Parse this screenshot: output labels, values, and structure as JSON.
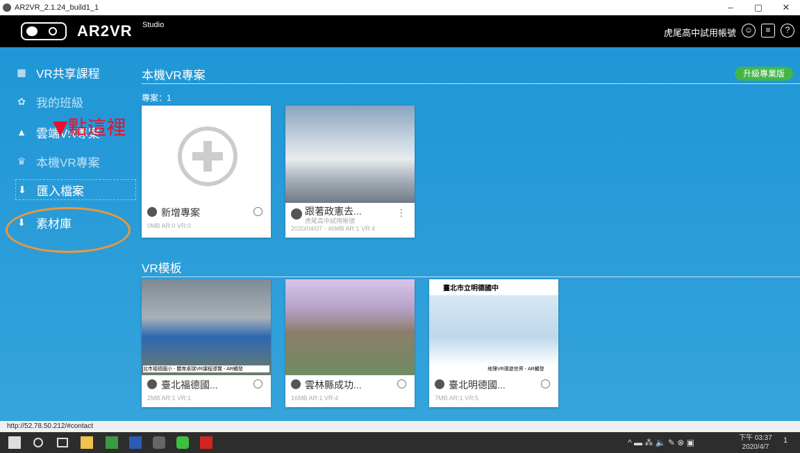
{
  "window": {
    "title": "AR2VR_2.1.24_build1_1",
    "min": "–",
    "max": "▢",
    "close": "✕"
  },
  "header": {
    "brand": "AR2VR",
    "brand_sub": "Studio",
    "account": "虎尾高中試用帳號",
    "icons": [
      "user-icon",
      "document-icon",
      "help-icon"
    ],
    "help_glyph": "?"
  },
  "sidebar": {
    "items": [
      {
        "label": "VR共享課程",
        "icon": "grid-icon"
      },
      {
        "label": "我的班級",
        "icon": "group-icon"
      },
      {
        "label": "雲端VR專案",
        "icon": "cloud-icon"
      },
      {
        "label": "本機VR專案",
        "icon": "local-icon"
      },
      {
        "label": "匯入檔案",
        "icon": "import-icon"
      },
      {
        "label": "素材庫",
        "icon": "library-icon"
      }
    ]
  },
  "annotation": {
    "text": "▼點這裡",
    "color": "#e8102a"
  },
  "local": {
    "title": "本機VR專案",
    "count": "專案：1",
    "upgrade": "升級專業版",
    "cards": [
      {
        "title": "新增專案",
        "meta": "0MB AR:0 VR:0"
      },
      {
        "title": "跟著政憲去...",
        "subtitle": "虎尾高中試用帳號",
        "meta": "2020/04/07 - 46MB AR:1 VR:4"
      }
    ]
  },
  "templates": {
    "title": "VR模板",
    "cards": [
      {
        "title": "臺北福德國...",
        "meta": "2MB AR:1 VR:1",
        "caption": "北市福德國小 - 體育桌球VR課程導覽 - AR觸發"
      },
      {
        "title": "雲林縣成功...",
        "meta": "16MB AR:1 VR:4"
      },
      {
        "title": "臺北明德國...",
        "meta": "7MB AR:1 VR:5",
        "banner": "臺北市立明德國中",
        "caption": "地理VR環遊世界 - AR觸發"
      }
    ]
  },
  "statusbar": {
    "url": "http://52.78.50.212/#contact"
  },
  "taskbar": {
    "time": "下午 03:37",
    "date": "2020/4/7",
    "notif": "1",
    "tray_icons": "^ ▬ ⁂ 🔈 ✎ ⊗ ▣"
  },
  "colors": {
    "accent_blue": "#2096d6",
    "upgrade_green": "#43b54a",
    "highlight_orange": "#f0963a"
  }
}
